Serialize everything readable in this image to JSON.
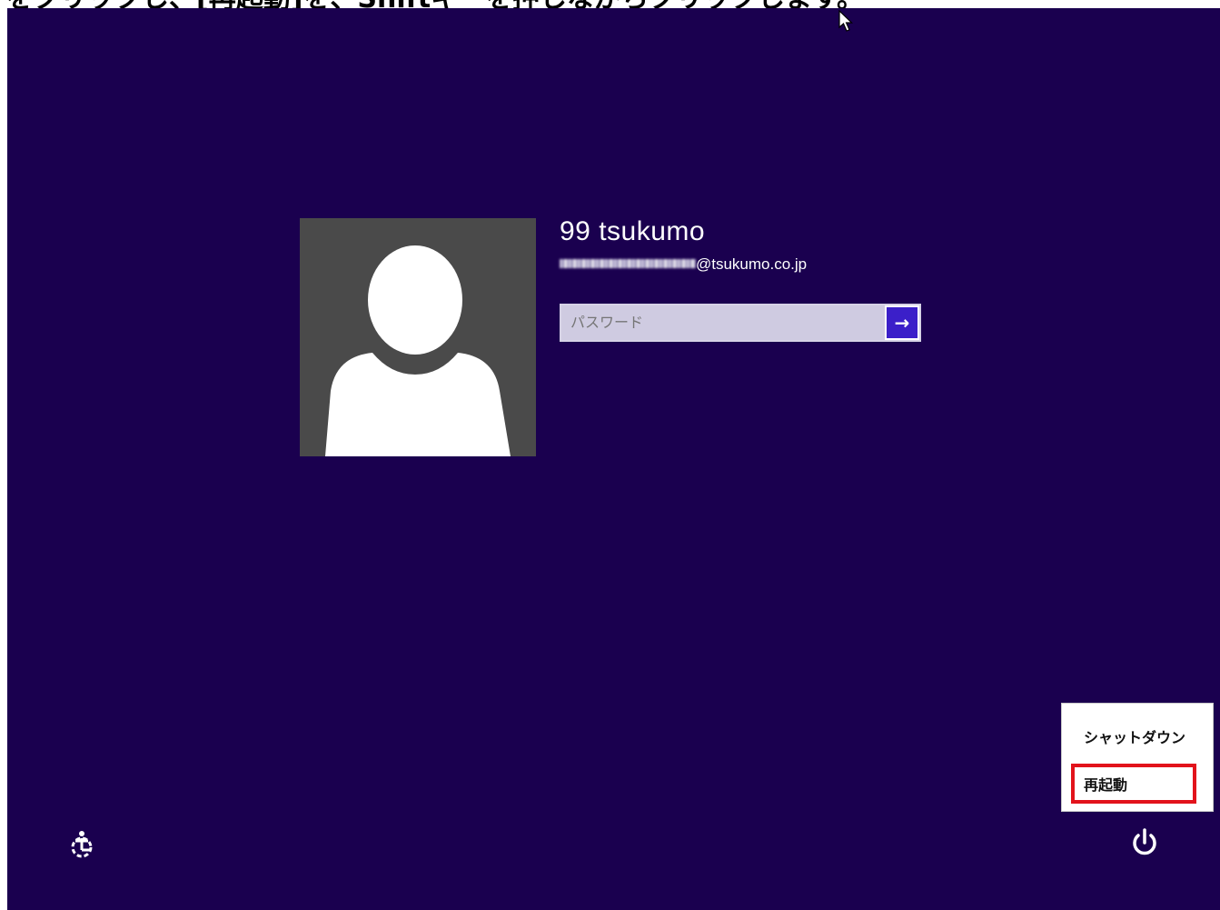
{
  "caption": {
    "pre": "をクリックし、[再起動]を、",
    "link": "Shiftキーを押しながら",
    "post": "クリックします。"
  },
  "user": {
    "name": "99 tsukumo",
    "email_domain": "@tsukumo.co.jp"
  },
  "password": {
    "placeholder": "パスワード",
    "submit_glyph": "→"
  },
  "power_menu": {
    "items": [
      {
        "label": "シャットダウン"
      },
      {
        "label": "再起動",
        "highlighted": true
      }
    ]
  },
  "icons": {
    "cursor": "mouse-pointer-icon",
    "ease_of_access": "ease-of-access-icon",
    "power": "power-icon",
    "arrow": "arrow-right-icon"
  },
  "colors": {
    "background": "#1a004f",
    "accent": "#3b1fc9",
    "avatar_bg": "#4a4a4a",
    "highlight": "#e2131b"
  }
}
